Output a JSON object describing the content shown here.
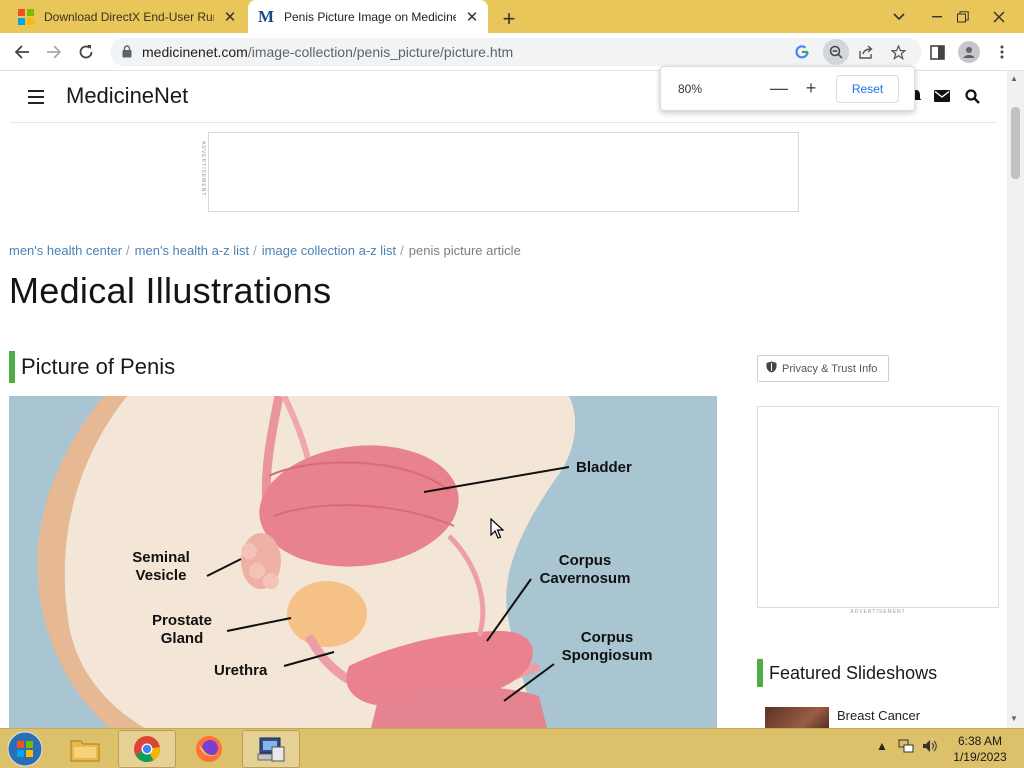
{
  "tabs": [
    {
      "title": "Download DirectX End-User Runti",
      "favicon": "microsoft-logo",
      "active": false
    },
    {
      "title": "Penis Picture Image on Medicine",
      "favicon": "medicinenet-logo",
      "active": true
    }
  ],
  "newtab_label": "+",
  "toolbar": {
    "url_host": "medicinenet.com",
    "url_path": "/image-collection/penis_picture/picture.htm"
  },
  "zoom_popup": {
    "value": "80%",
    "minus": "—",
    "plus": "+",
    "reset": "Reset"
  },
  "site": {
    "name": "MedicineNet",
    "ad_label": "ADVERTISEMENT"
  },
  "breadcrumbs": [
    {
      "label": "men's health center",
      "link": true
    },
    {
      "label": "men's health a-z list",
      "link": true
    },
    {
      "label": "image collection a-z list",
      "link": true
    },
    {
      "label": "penis picture article",
      "link": false
    }
  ],
  "page_title": "Medical Illustrations",
  "section_title": "Picture of Penis",
  "illustration_labels": {
    "bladder": "Bladder",
    "seminal_vesicle_1": "Seminal",
    "seminal_vesicle_2": "Vesicle",
    "prostate_1": "Prostate",
    "prostate_2": "Gland",
    "urethra": "Urethra",
    "cavernosum_1": "Corpus",
    "cavernosum_2": "Cavernosum",
    "spongiosum_1": "Corpus",
    "spongiosum_2": "Spongiosum"
  },
  "sidebar": {
    "privacy_label": "Privacy & Trust Info",
    "ad_label": "ADVERTISEMENT",
    "featured_title": "Featured Slideshows",
    "slideshows": [
      {
        "title": "Breast Cancer"
      }
    ]
  },
  "taskbar": {
    "time": "6:38 AM",
    "date": "1/19/2023"
  },
  "colors": {
    "accent_green": "#4fae46",
    "link_blue": "#4a83b5",
    "taskbar": "#dcc06a",
    "tabstrip": "#e9c659"
  }
}
